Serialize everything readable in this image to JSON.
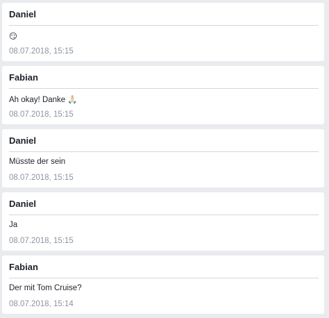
{
  "messages": [
    {
      "sender": "Daniel",
      "text": "😏",
      "timestamp": "08.07.2018, 15:15"
    },
    {
      "sender": "Fabian",
      "text": "Ah okay! Danke 🙏🏻",
      "timestamp": "08.07.2018, 15:15"
    },
    {
      "sender": "Daniel",
      "text": "Müsste der sein",
      "timestamp": "08.07.2018, 15:15"
    },
    {
      "sender": "Daniel",
      "text": "Ja",
      "timestamp": "08.07.2018, 15:15"
    },
    {
      "sender": "Fabian",
      "text": "Der mit Tom Cruise?",
      "timestamp": "08.07.2018, 15:14"
    }
  ]
}
